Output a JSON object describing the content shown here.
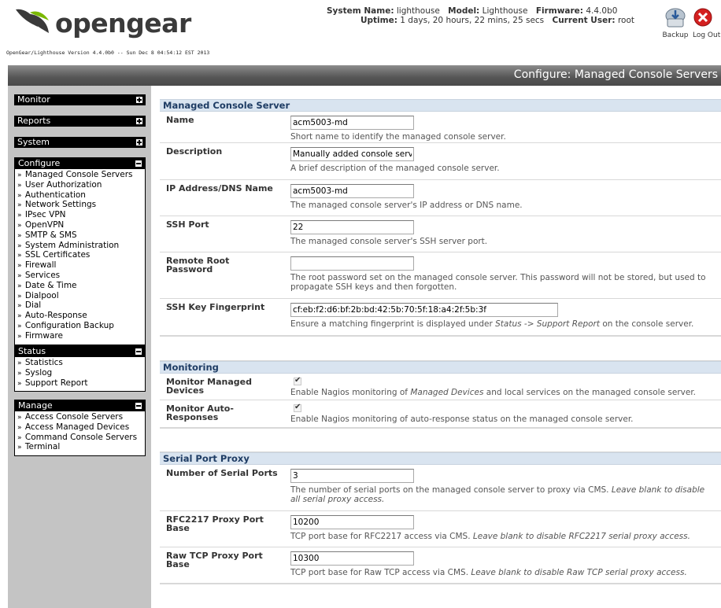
{
  "header": {
    "logo_text": "opengear",
    "system_name_label": "System Name:",
    "system_name": "lighthouse",
    "model_label": "Model:",
    "model": "Lighthouse",
    "firmware_label": "Firmware:",
    "firmware": "4.4.0b0",
    "uptime_label": "Uptime:",
    "uptime": "1 days, 20 hours, 22 mins, 25 secs",
    "current_user_label": "Current User:",
    "current_user": "root",
    "backup_label": "Backup",
    "logout_label": "Log Out",
    "version_line": "OpenGear/Lighthouse Version 4.4.0b0 --  Sun Dec 8 04:54:12 EST 2013"
  },
  "page_title": "Configure: Managed Console Servers",
  "sidebar": {
    "monitor": {
      "label": "Monitor"
    },
    "reports": {
      "label": "Reports"
    },
    "system": {
      "label": "System"
    },
    "configure": {
      "label": "Configure",
      "items": [
        "Managed Console Servers",
        "User Authorization",
        "Authentication",
        "Network Settings",
        "IPsec VPN",
        "OpenVPN",
        "SMTP & SMS",
        "System Administration",
        "SSL Certificates",
        "Firewall",
        "Services",
        "Date & Time",
        "Dialpool",
        "Dial",
        "Auto-Response",
        "Configuration Backup",
        "Firmware"
      ]
    },
    "status": {
      "label": "Status",
      "items": [
        "Statistics",
        "Syslog",
        "Support Report"
      ]
    },
    "manage": {
      "label": "Manage",
      "items": [
        "Access Console Servers",
        "Access Managed Devices",
        "Command Console Servers",
        "Terminal"
      ]
    },
    "bullet": "»"
  },
  "sections": {
    "managed": {
      "title": "Managed Console Server",
      "name": {
        "label": "Name",
        "value": "acm5003-md",
        "help": "Short name to identify the managed console server."
      },
      "description": {
        "label": "Description",
        "value": "Manually added console server",
        "help": "A brief description of the managed console server."
      },
      "ip": {
        "label": "IP Address/DNS Name",
        "value": "acm5003-md",
        "help": "The managed console server's IP address or DNS name."
      },
      "ssh_port": {
        "label": "SSH Port",
        "value": "22",
        "help": "The managed console server's SSH server port."
      },
      "root_password": {
        "label": "Remote Root Password",
        "value": "",
        "help": "The root password set on the managed console server. This password will not be stored, but used to propagate SSH keys and then forgotten."
      },
      "fingerprint": {
        "label": "SSH Key Fingerprint",
        "value": "cf:eb:f2:d6:bf:2b:bd:42:5b:70:5f:18:a4:2f:5b:3f",
        "help_pre": "Ensure a matching fingerprint is displayed under ",
        "help_em": "Status -> Support Report",
        "help_post": " on the console server."
      }
    },
    "monitoring": {
      "title": "Monitoring",
      "managed_devices": {
        "label": "Monitor Managed Devices",
        "checked": true,
        "help_pre": "Enable Nagios monitoring of ",
        "help_em": "Managed Devices",
        "help_post": " and local services on the managed console server."
      },
      "auto_responses": {
        "label": "Monitor Auto-Responses",
        "checked": true,
        "help": "Enable Nagios monitoring of auto-response status on the managed console server."
      }
    },
    "proxy": {
      "title": "Serial Port Proxy",
      "num_ports": {
        "label": "Number of Serial Ports",
        "value": "3",
        "help_pre": "The number of serial ports on the managed console server to proxy via CMS. ",
        "help_em": "Leave blank to disable all serial proxy access."
      },
      "rfc2217": {
        "label": "RFC2217 Proxy Port Base",
        "value": "10200",
        "help_pre": "TCP port base for RFC2217 access via CMS. ",
        "help_em": "Leave blank to disable RFC2217 serial proxy access."
      },
      "raw_tcp": {
        "label": "Raw TCP Proxy Port Base",
        "value": "10300",
        "help_pre": "TCP port base for Raw TCP access via CMS. ",
        "help_em": "Leave blank to disable Raw TCP serial proxy access."
      }
    }
  },
  "colors": {
    "section_header_bg": "#d9e4f0",
    "section_header_text": "#1e3c64",
    "titlebar": "#555555",
    "logo_green": "#7ab800"
  }
}
